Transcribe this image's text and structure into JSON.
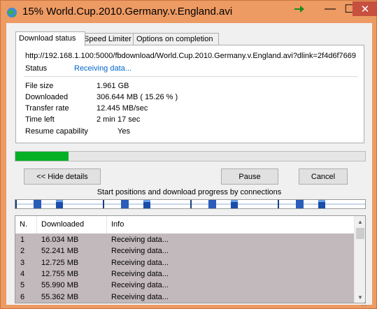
{
  "window": {
    "title": "15% World.Cup.2010.Germany.v.England.avi",
    "accent": "#ed9a63",
    "close_color": "#c7503e"
  },
  "titlebar_buttons": {
    "arrow": "green-arrow-icon",
    "minimize": "—",
    "maximize": "☐",
    "close": "✕"
  },
  "tabs": [
    {
      "label": "Download status",
      "active": true
    },
    {
      "label": "Speed Limiter",
      "active": false
    },
    {
      "label": "Options on completion",
      "active": false
    }
  ],
  "status_panel": {
    "url": "http://192.168.1.100:5000/fbdownload/World.Cup.2010.Germany.v.England.avi?dlink=2f4d6f7669",
    "status_label": "Status",
    "status_value": "Receiving data...",
    "rows": [
      {
        "label": "File size",
        "value": "1.961  GB"
      },
      {
        "label": "Downloaded",
        "value": "306.644  MB  ( 15.26 % )"
      },
      {
        "label": "Transfer rate",
        "value": "12.445  MB/sec"
      },
      {
        "label": "Time left",
        "value": "2 min 17 sec"
      },
      {
        "label": "Resume capability",
        "value": "Yes"
      }
    ]
  },
  "progress": {
    "fraction": 0.1526,
    "color": "#06b025"
  },
  "buttons": {
    "hide_details": "<< Hide details",
    "pause": "Pause",
    "cancel": "Cancel"
  },
  "connections_caption": "Start positions and download progress by connections",
  "connections": [
    {
      "start": 0.0,
      "progress": 0.13
    },
    {
      "start": 0.25,
      "progress": 0.13
    },
    {
      "start": 0.5,
      "progress": 0.13
    },
    {
      "start": 0.75,
      "progress": 0.13
    }
  ],
  "table": {
    "columns": [
      "N.",
      "Downloaded",
      "Info"
    ],
    "rows": [
      [
        "1",
        "16.034  MB",
        "Receiving data..."
      ],
      [
        "2",
        "52.241  MB",
        "Receiving data..."
      ],
      [
        "3",
        "12.725  MB",
        "Receiving data..."
      ],
      [
        "4",
        "12.755  MB",
        "Receiving data..."
      ],
      [
        "5",
        "55.990  MB",
        "Receiving data..."
      ],
      [
        "6",
        "55.362  MB",
        "Receiving data..."
      ]
    ]
  }
}
